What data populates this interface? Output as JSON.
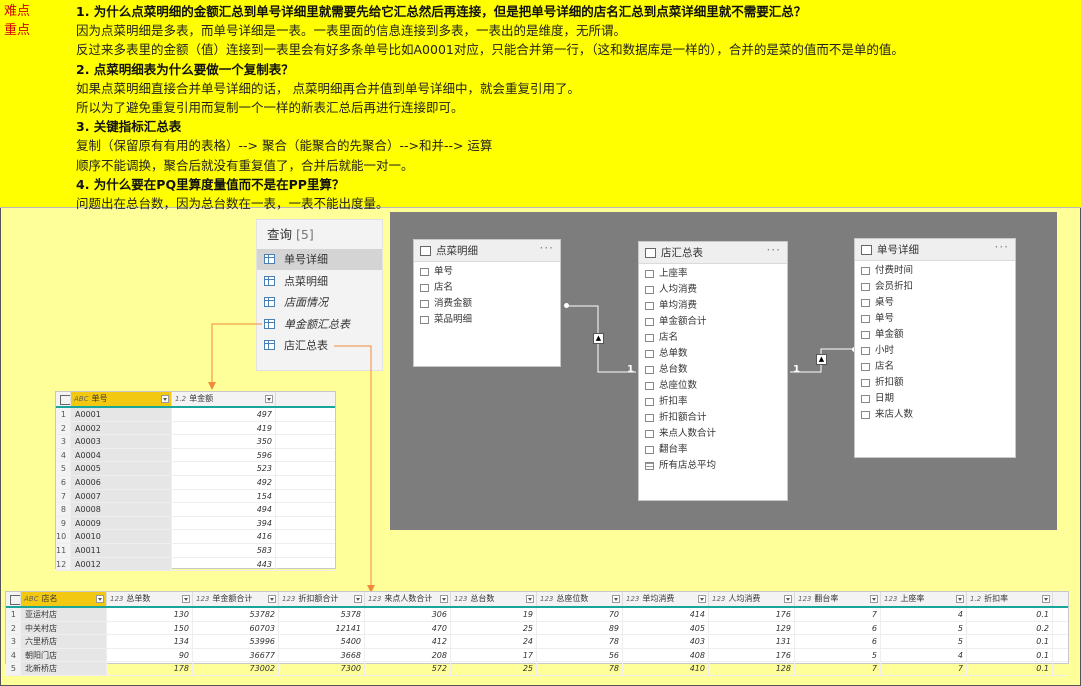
{
  "notes": {
    "tags": [
      "难点",
      "重点"
    ],
    "lines": [
      {
        "text": "1. 为什么点菜明细的金额汇总到单号详细里就需要先给它汇总然后再连接，但是把单号详细的店名汇总到点菜详细里就不需要汇总？",
        "bold": true
      },
      {
        "text": "因为点菜明细是多表，而单号详细是一表。一表里面的信息连接到多表，一表出的是维度，无所谓。",
        "bold": false
      },
      {
        "text": "反过来多表里的金额（值）连接到一表里会有好多条单号比如A0001对应，只能合并第一行，（这和数据库是一样的），合并的是菜的值而不是单的值。",
        "bold": false
      },
      {
        "text": "2. 点菜明细表为什么要做一个复制表？",
        "bold": true
      },
      {
        "text": "如果点菜明细直接合并单号详细的话，  点菜明细再合并值到单号详细中，就会重复引用了。",
        "bold": false
      },
      {
        "text": "所以为了避免重复引用而复制一个一样的新表汇总后再进行连接即可。",
        "bold": false
      },
      {
        "text": "3. 关键指标汇总表",
        "bold": true
      },
      {
        "text": "复制（保留原有有用的表格）--> 聚合（能聚合的先聚合）-->和并--> 运算",
        "bold": false
      },
      {
        "text": "顺序不能调换，聚合后就没有重复值了，合并后就能一对一。",
        "bold": false
      },
      {
        "text": "4. 为什么要在PQ里算度量值而不是在PP里算？",
        "bold": true
      },
      {
        "text": "问题出在总台数，因为总台数在一表，一表不能出度量。",
        "bold": false
      }
    ]
  },
  "query_pane": {
    "title": "查询",
    "count": "[5]",
    "items": [
      {
        "label": "单号详细",
        "selected": true,
        "italic": false
      },
      {
        "label": "点菜明细",
        "selected": false,
        "italic": false
      },
      {
        "label": "店面情况",
        "selected": false,
        "italic": true
      },
      {
        "label": "单金额汇总表",
        "selected": false,
        "italic": true
      },
      {
        "label": "店汇总表",
        "selected": false,
        "italic": false
      }
    ]
  },
  "model": {
    "tables": [
      {
        "name": "点菜明细",
        "fields": [
          "单号",
          "店名",
          "消费金额",
          "菜品明细"
        ]
      },
      {
        "name": "店汇总表",
        "fields": [
          "上座率",
          "人均消费",
          "单均消费",
          "单金额合计",
          "店名",
          "总单数",
          "总台数",
          "总座位数",
          "折扣率",
          "折扣额合计",
          "来点人数合计",
          "翻台率",
          "所有店总平均"
        ]
      },
      {
        "name": "单号详细",
        "fields": [
          "付费时间",
          "会员折扣",
          "桌号",
          "单号",
          "单金额",
          "小时",
          "店名",
          "折扣额",
          "日期",
          "来店人数"
        ]
      }
    ],
    "rel_labels": [
      "1",
      "1"
    ]
  },
  "grid_small": {
    "columns": [
      {
        "type": "ABC",
        "label": "单号"
      },
      {
        "type": "1.2",
        "label": "单金额"
      }
    ],
    "rows": [
      [
        "1",
        "A0001",
        "497"
      ],
      [
        "2",
        "A0002",
        "419"
      ],
      [
        "3",
        "A0003",
        "350"
      ],
      [
        "4",
        "A0004",
        "596"
      ],
      [
        "5",
        "A0005",
        "523"
      ],
      [
        "6",
        "A0006",
        "492"
      ],
      [
        "7",
        "A0007",
        "154"
      ],
      [
        "8",
        "A0008",
        "494"
      ],
      [
        "9",
        "A0009",
        "394"
      ],
      [
        "10",
        "A0010",
        "416"
      ],
      [
        "11",
        "A0011",
        "583"
      ],
      [
        "12",
        "A0012",
        "443"
      ]
    ]
  },
  "grid_big": {
    "columns": [
      {
        "type": "ABC",
        "label": "店名"
      },
      {
        "type": "123",
        "label": "总单数"
      },
      {
        "type": "123",
        "label": "单金额合计"
      },
      {
        "type": "123",
        "label": "折扣额合计"
      },
      {
        "type": "123",
        "label": "来点人数合计"
      },
      {
        "type": "123",
        "label": "总台数"
      },
      {
        "type": "123",
        "label": "总座位数"
      },
      {
        "type": "123",
        "label": "单均消费"
      },
      {
        "type": "123",
        "label": "人均消费"
      },
      {
        "type": "123",
        "label": "翻台率"
      },
      {
        "type": "123",
        "label": "上座率"
      },
      {
        "type": "1.2",
        "label": "折扣率"
      }
    ],
    "rows": [
      [
        "1",
        "亚运村店",
        "130",
        "53782",
        "5378",
        "306",
        "19",
        "70",
        "414",
        "176",
        "7",
        "4",
        "0.1"
      ],
      [
        "2",
        "中关村店",
        "150",
        "60703",
        "12141",
        "470",
        "25",
        "89",
        "405",
        "129",
        "6",
        "5",
        "0.2"
      ],
      [
        "3",
        "六里桥店",
        "134",
        "53996",
        "5400",
        "412",
        "24",
        "78",
        "403",
        "131",
        "6",
        "5",
        "0.1"
      ],
      [
        "4",
        "朝阳门店",
        "90",
        "36677",
        "3668",
        "208",
        "17",
        "56",
        "408",
        "176",
        "5",
        "4",
        "0.1"
      ],
      [
        "5",
        "北新桥店",
        "178",
        "73002",
        "7300",
        "572",
        "25",
        "78",
        "410",
        "128",
        "7",
        "7",
        "0.1"
      ]
    ]
  },
  "colors": {
    "notes_bg": "#ffff00",
    "page_bg": "#ffff99",
    "tag_red": "#d20000",
    "arrow_orange": "#f08a3c",
    "model_bg": "#7d7d7d",
    "header_accent": "#1aa59a",
    "key_col": "#f2c811"
  }
}
